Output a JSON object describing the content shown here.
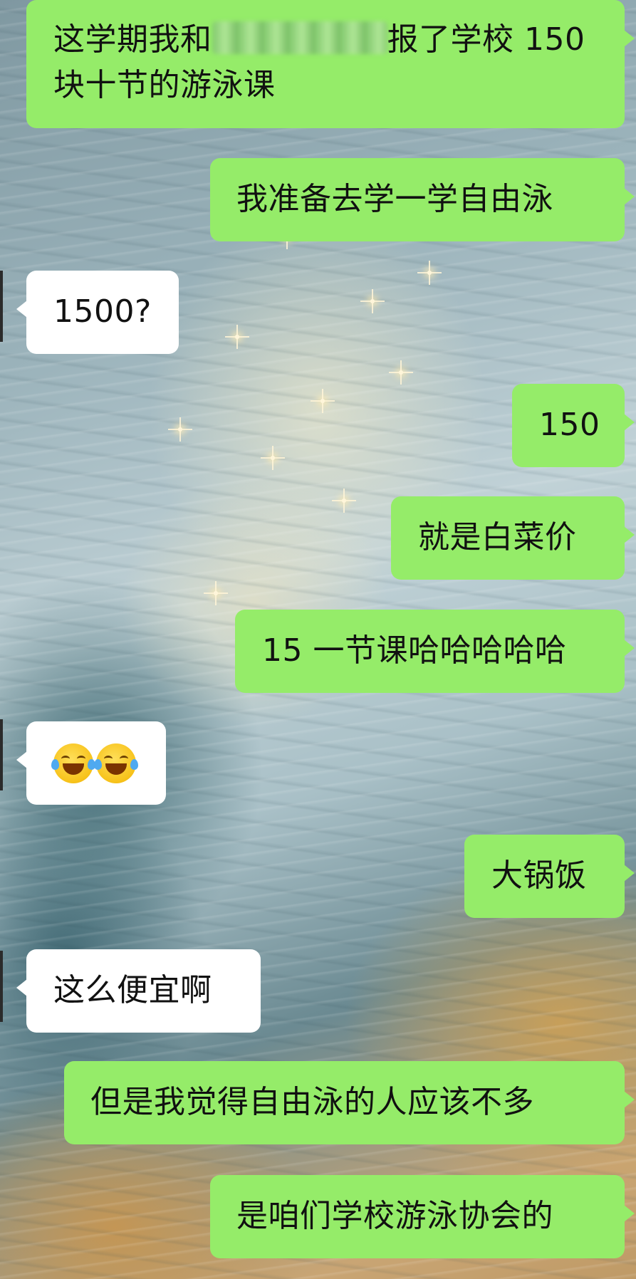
{
  "chat": {
    "messages": [
      {
        "side": "out",
        "text_before": "这学期我和",
        "text_after": "报了学校 150",
        "line2": "块十节的游泳课",
        "redacted": true
      },
      {
        "side": "out",
        "text": "我准备去学一学自由泳"
      },
      {
        "side": "in",
        "text": "1500?"
      },
      {
        "side": "out",
        "text": "150"
      },
      {
        "side": "out",
        "text": "就是白菜价"
      },
      {
        "side": "out",
        "text": "15 一节课哈哈哈哈哈"
      },
      {
        "side": "in",
        "emoji": [
          "face-with-tears-of-joy",
          "face-with-tears-of-joy"
        ]
      },
      {
        "side": "out",
        "text": "大锅饭"
      },
      {
        "side": "in",
        "text": "这么便宜啊"
      },
      {
        "side": "out",
        "text": "但是我觉得自由泳的人应该不多"
      },
      {
        "side": "out",
        "text": "是咱们学校游泳协会的"
      }
    ]
  },
  "colors": {
    "outgoing_bubble": "#95ec69",
    "incoming_bubble": "#ffffff",
    "text": "#111111"
  }
}
